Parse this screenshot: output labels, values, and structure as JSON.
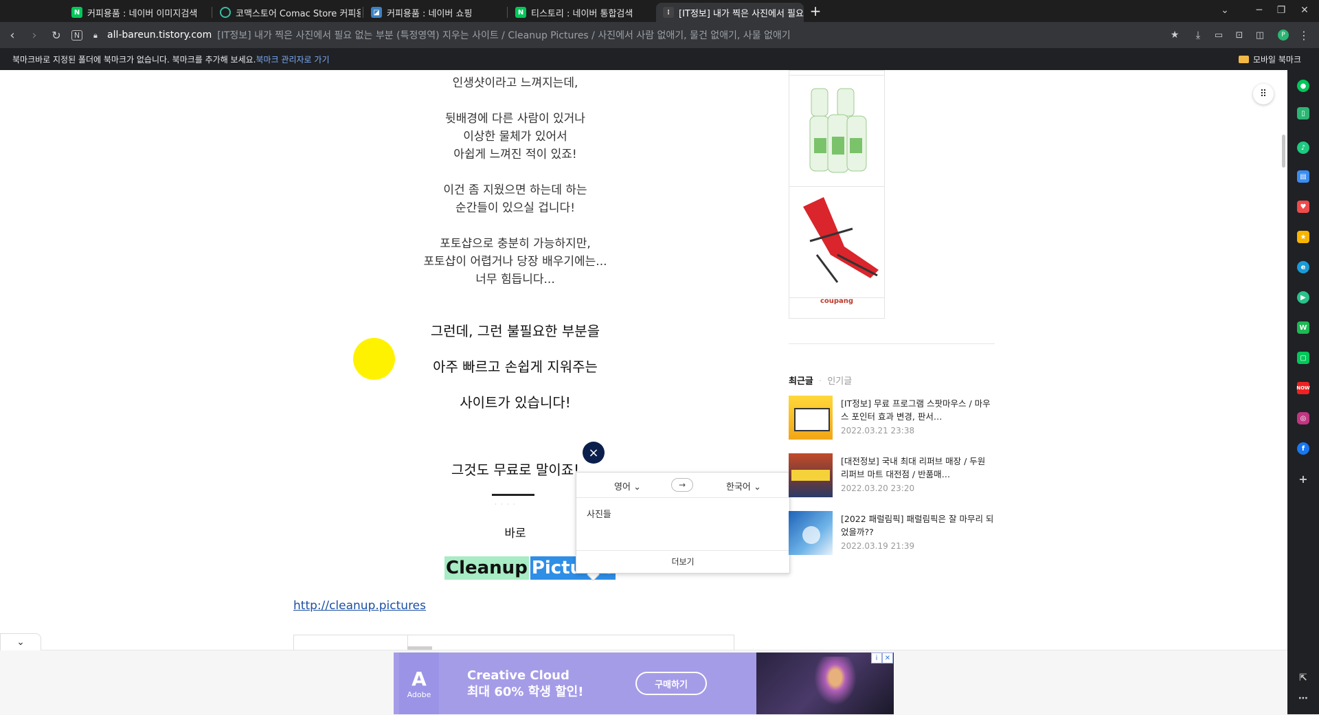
{
  "tabs": [
    {
      "label": "커피용품 : 네이버 이미지검색",
      "favicon": "naver-icon"
    },
    {
      "label": "코맥스토어 Comac Store 커피용",
      "favicon": "comac-icon"
    },
    {
      "label": "커피용품 : 네이버 쇼핑",
      "favicon": "naver-shopping-icon"
    },
    {
      "label": "티스토리 : 네이버 통합검색",
      "favicon": "naver-icon"
    },
    {
      "label": "[IT정보] 내가 찍은 사진에서 필요",
      "favicon": "tistory-icon",
      "active": true
    }
  ],
  "address_bar": {
    "domain": "all-bareun.tistory.com",
    "title": "[IT정보] 내가 찍은 사진에서 필요 없는 부분 (특정영역) 지우는 사이트 / Cleanup Pictures / 사진에서 사람 없애기, 물건 없애기, 사물 없애기"
  },
  "bookmark_bar": {
    "message": "북마크바로 지정된 폴더에 북마크가 없습니다. 북마크를 추가해 보세요.",
    "manage_link": "북마크 관리자로 가기",
    "mobile_bookmarks": "모바일 북마크"
  },
  "article": {
    "line_top": "인생샷이라고 느껴지는데,",
    "para1": [
      "뒷배경에 다른 사람이 있거나",
      "이상한 물체가 있어서",
      "아쉽게 느껴진 적이 있죠!"
    ],
    "para2": [
      "이건 좀 지웠으면 하는데 하는",
      "순간들이 있으실 겁니다!"
    ],
    "para3": [
      "포토샵으로 충분히 가능하지만,",
      "포토샵이 어렵거나 당장 배우기에는...",
      "너무 힘듭니다..."
    ],
    "big1": "그런데, 그런 불필요한 부분을",
    "big2": "아주 빠르고 손쉽게 지워주는",
    "big3": "사이트가 있습니다!",
    "big4": "그것도 무료로 말이죠!",
    "baro": "바로",
    "cleanup_word1": "Cleanup",
    "cleanup_word2": "Pictures",
    "link": "http://cleanup.pictures"
  },
  "translate_popup": {
    "source_lang": "영어",
    "target_lang": "한국어",
    "swap_symbol": "→",
    "result": "사진들",
    "more": "더보기",
    "close_symbol": "×"
  },
  "sidebar": {
    "ad_brand": "coupang",
    "tab_recent": "최근글",
    "tab_popular": "인기글",
    "posts": [
      {
        "title": "[IT정보] 무료 프로그램 스팟마우스 / 마우스 포인터 효과 변경, 판서…",
        "date": "2022.03.21 23:38"
      },
      {
        "title": "[대전정보] 국내 최대 리퍼브 매장 / 두원 리퍼브 마트 대전점 / 반품매…",
        "date": "2022.03.20 23:20"
      },
      {
        "title": "[2022 패럴림픽] 패럴림픽은 잘 마무리 되었을까??",
        "date": "2022.03.19 21:39"
      }
    ]
  },
  "bottom_ad": {
    "brand": "Adobe",
    "headline1": "Creative Cloud",
    "headline2": "최대 60% 학생 할인!",
    "button": "구매하기"
  },
  "colors": {
    "accent_green": "#a7ecc4",
    "accent_blue": "#2f8ee6",
    "highlight_yellow": "#fff200",
    "chrome_dark": "#35363a"
  }
}
